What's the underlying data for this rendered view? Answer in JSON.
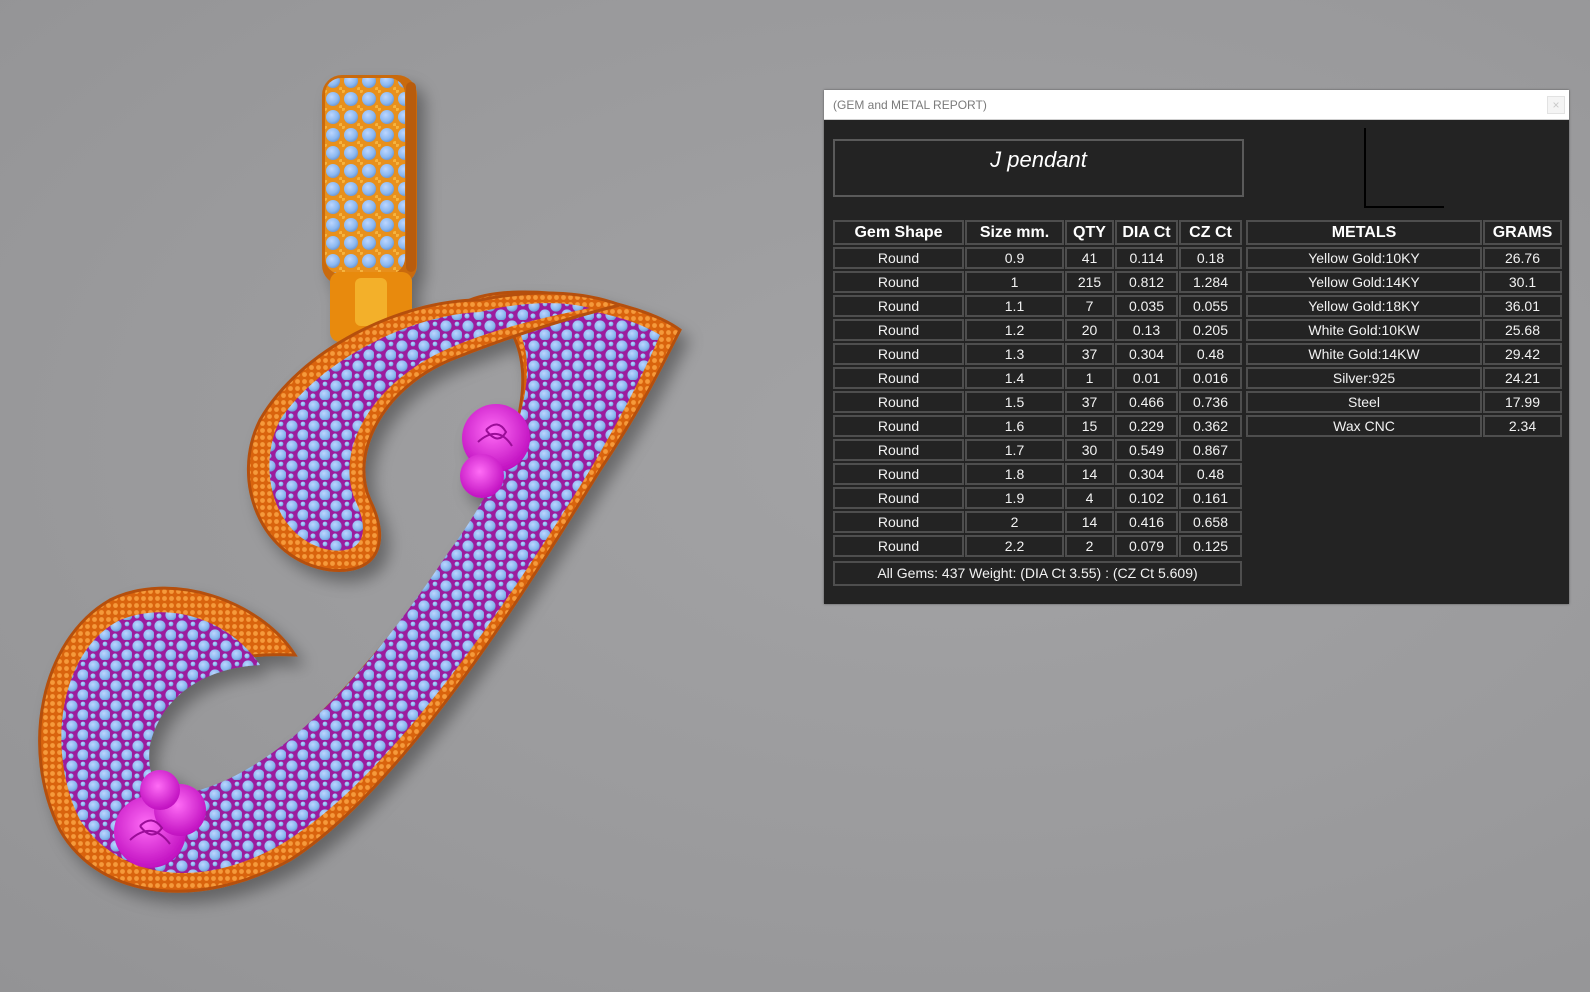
{
  "window": {
    "title": "(GEM and METAL REPORT)",
    "close_symbol": "×"
  },
  "item_name": "J pendant",
  "gem_table": {
    "headers": [
      "Gem Shape",
      "Size mm.",
      "QTY",
      "DIA Ct",
      "CZ Ct"
    ],
    "rows": [
      [
        "Round",
        "0.9",
        "41",
        "0.114",
        "0.18"
      ],
      [
        "Round",
        "1",
        "215",
        "0.812",
        "1.284"
      ],
      [
        "Round",
        "1.1",
        "7",
        "0.035",
        "0.055"
      ],
      [
        "Round",
        "1.2",
        "20",
        "0.13",
        "0.205"
      ],
      [
        "Round",
        "1.3",
        "37",
        "0.304",
        "0.48"
      ],
      [
        "Round",
        "1.4",
        "1",
        "0.01",
        "0.016"
      ],
      [
        "Round",
        "1.5",
        "37",
        "0.466",
        "0.736"
      ],
      [
        "Round",
        "1.6",
        "15",
        "0.229",
        "0.362"
      ],
      [
        "Round",
        "1.7",
        "30",
        "0.549",
        "0.867"
      ],
      [
        "Round",
        "1.8",
        "14",
        "0.304",
        "0.48"
      ],
      [
        "Round",
        "1.9",
        "4",
        "0.102",
        "0.161"
      ],
      [
        "Round",
        "2",
        "14",
        "0.416",
        "0.658"
      ],
      [
        "Round",
        "2.2",
        "2",
        "0.079",
        "0.125"
      ]
    ],
    "summary": "All Gems: 437  Weight: (DIA Ct 3.55) : (CZ Ct 5.609)"
  },
  "metal_table": {
    "headers": [
      "METALS",
      "GRAMS"
    ],
    "rows": [
      [
        "Yellow Gold:10KY",
        "26.76"
      ],
      [
        "Yellow Gold:14KY",
        "30.1"
      ],
      [
        "Yellow Gold:18KY",
        "36.01"
      ],
      [
        "White Gold:10KW",
        "25.68"
      ],
      [
        "White Gold:14KW",
        "29.42"
      ],
      [
        "Silver:925",
        "24.21"
      ],
      [
        "Steel",
        "17.99"
      ],
      [
        "Wax  CNC",
        "2.34"
      ]
    ]
  },
  "colors": {
    "metal": "#e8761c",
    "bail": "#f0a020",
    "enamel": "#9c1a9e",
    "gems": "#8bb8f0",
    "roses": "#e21ee0",
    "panel_bg": "#232323"
  },
  "icons": [
    "close-icon"
  ]
}
